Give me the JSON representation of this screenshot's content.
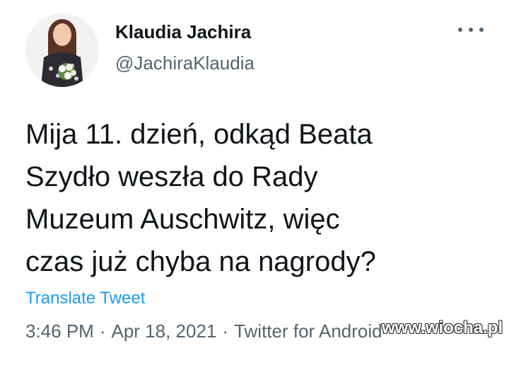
{
  "author": {
    "display_name": "Klaudia Jachira",
    "handle": "@JachiraKlaudia",
    "avatar_icon": "profile-photo"
  },
  "menu": {
    "icon": "more-icon"
  },
  "tweet": {
    "lines": [
      "Mija 11. dzień, odkąd Beata",
      "Szydło weszła do Rady",
      "Muzeum Auschwitz, więc",
      "czas już chyba na nagrody?"
    ],
    "translate_label": "Translate Tweet"
  },
  "meta": {
    "time": "3:46 PM",
    "date": "Apr 18, 2021",
    "source": "Twitter for Android",
    "separator": "·"
  },
  "watermark": "www.wiocha.pl",
  "colors": {
    "text": "#0f1419",
    "secondary": "#536471",
    "link": "#1d9bf0"
  }
}
